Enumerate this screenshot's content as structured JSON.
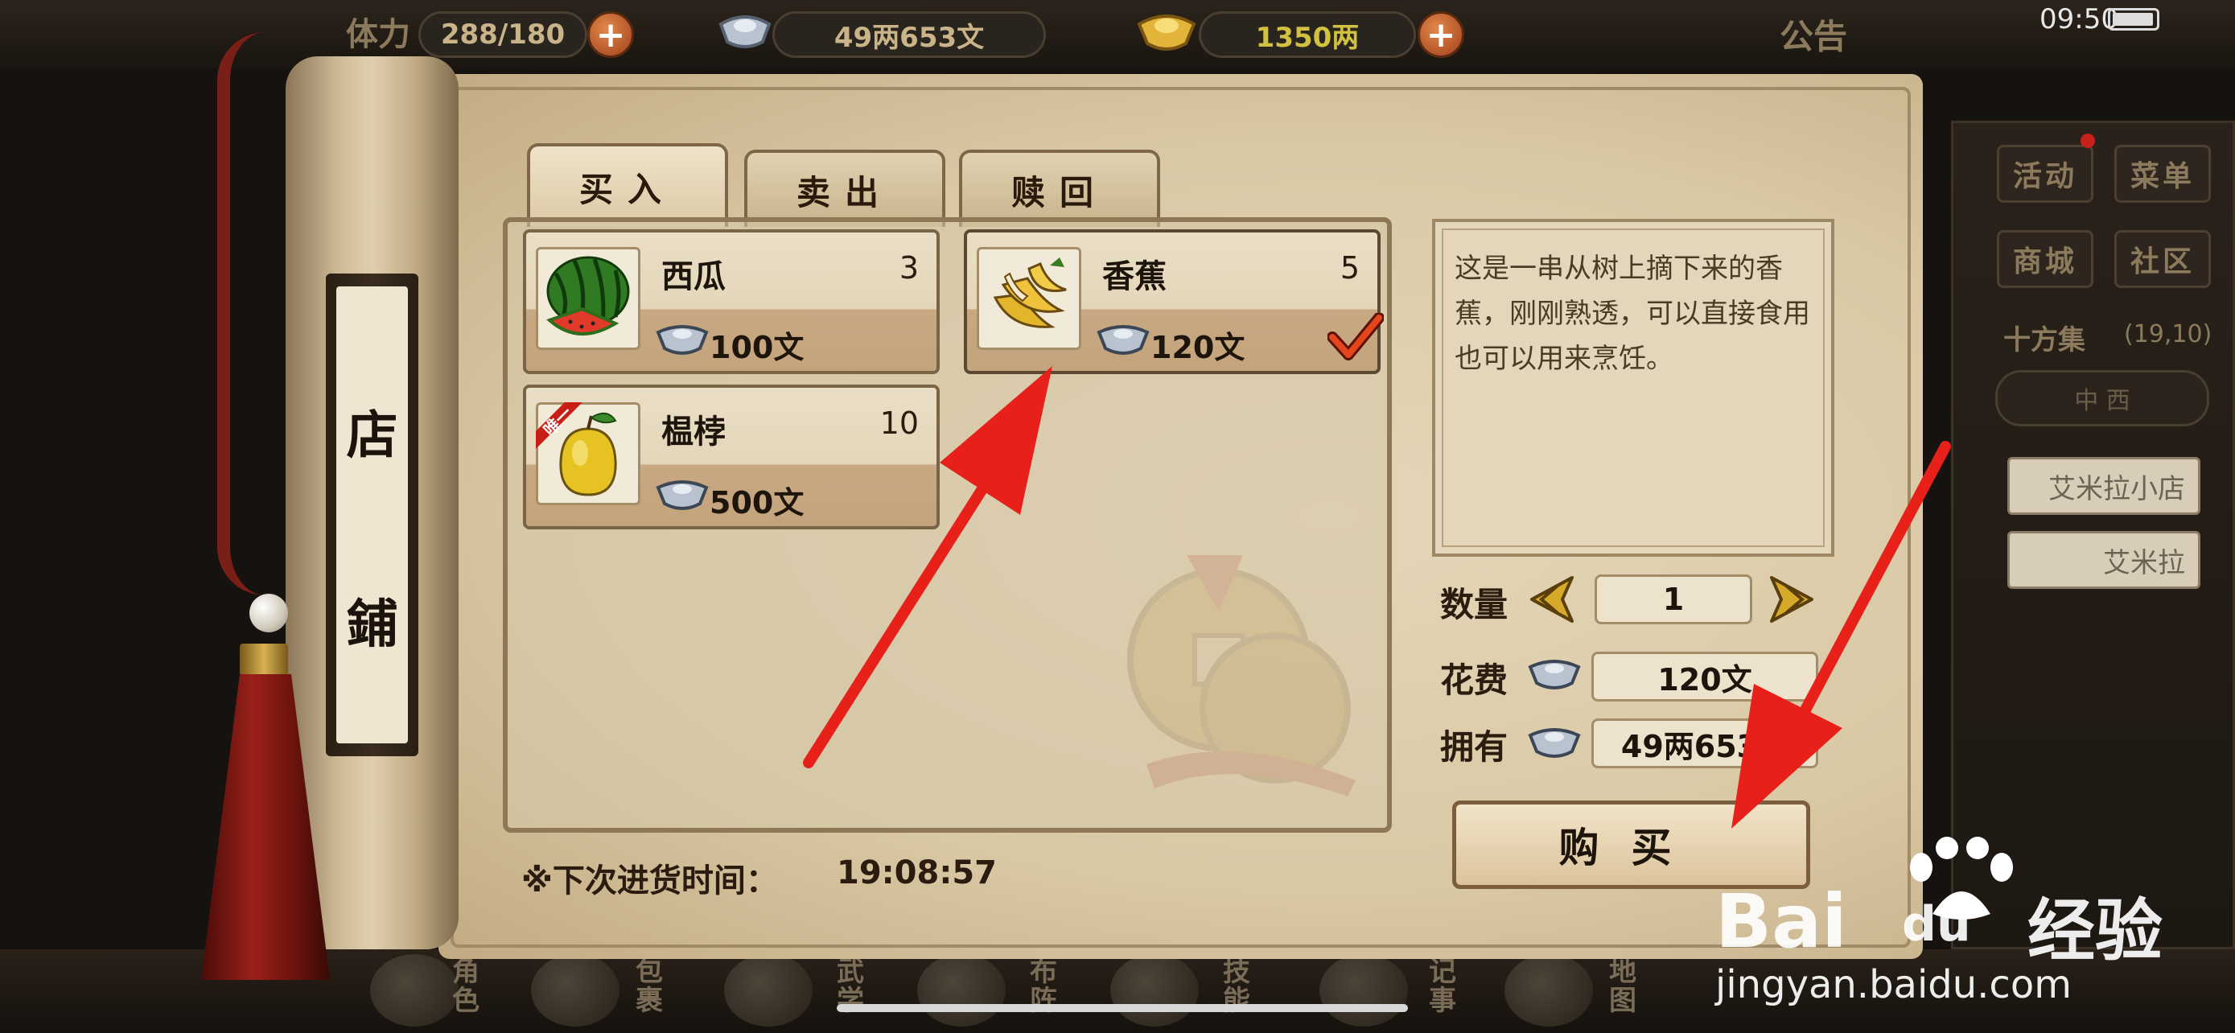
{
  "status_bar": {
    "stamina_label": "体力",
    "stamina": "288/180",
    "silver": "49两653文",
    "gold": "1350两",
    "notice": "公告",
    "time": "09:50"
  },
  "hud": {
    "buttons": [
      "活动",
      "菜单",
      "商城",
      "社区"
    ],
    "location": "十方集",
    "coords": "(19,10)",
    "compass": "中  西",
    "npcs": [
      "艾米拉小店",
      "艾米拉"
    ]
  },
  "bottom_nav": [
    "角色",
    "包裹",
    "武学",
    "布阵",
    "技能",
    "记事",
    "地图"
  ],
  "shop": {
    "title_chars": [
      "店",
      "鋪"
    ],
    "tabs": [
      "买入",
      "卖出",
      "赎回"
    ],
    "active_tab": "买入",
    "items": [
      {
        "name": "西瓜",
        "count": "3",
        "price": "100文",
        "icon": "watermelon-icon",
        "selected": false
      },
      {
        "name": "香蕉",
        "count": "5",
        "price": "120文",
        "icon": "banana-icon",
        "selected": true
      },
      {
        "name": "榅桲",
        "count": "10",
        "price": "500文",
        "icon": "quince-icon",
        "badge": "唯一",
        "selected": false
      }
    ],
    "description": "这是一串从树上摘下来的香蕉，刚刚熟透，可以直接食用也可以用来烹饪。",
    "quantity_label": "数量",
    "quantity": "1",
    "cost_label": "花费",
    "cost": "120文",
    "owned_label": "拥有",
    "owned": "49两653文",
    "buy_label": "购买",
    "restock_label": "※下次进货时间：",
    "restock_time": "19:08:57"
  },
  "watermark": {
    "brand": "Bai",
    "brand2": "du",
    "cn": "经验",
    "url": "jingyan.baidu.com"
  },
  "colors": {
    "annotation_arrow": "#e8201a",
    "paper": "#ddcdab",
    "accent_red": "#9a2018"
  }
}
